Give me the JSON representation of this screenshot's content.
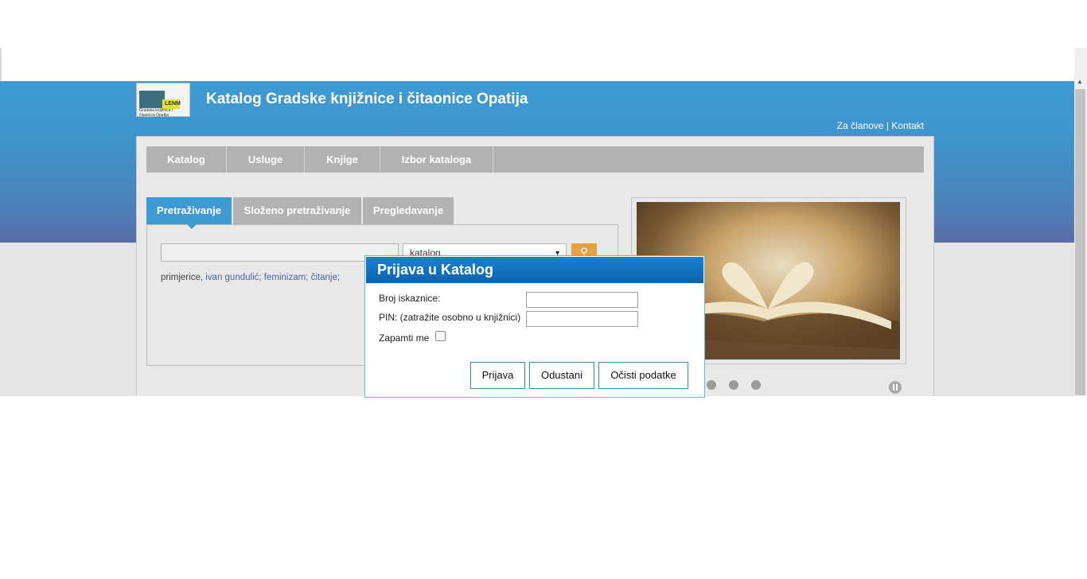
{
  "header": {
    "title": "Katalog Gradske knjižnice i čitaonice Opatija",
    "logo_text": "LENM",
    "logo_tagline": "Gradska knjižnica i čitaonica Opatija",
    "links": {
      "members": "Za članove",
      "separator": "|",
      "contact": "Kontakt"
    }
  },
  "menu": [
    "Katalog",
    "Usluge",
    "Knjige",
    "Izbor kataloga"
  ],
  "tabs": [
    "Pretraživanje",
    "Složeno pretraživanje",
    "Pregledavanje"
  ],
  "search": {
    "query": "",
    "select_value": "katalog",
    "tags_prefix": "primjerice,",
    "tags": [
      "ivan gundulić;",
      "feminizam;",
      "čitanje;"
    ]
  },
  "slider": {
    "dots": 3,
    "image_icon": "book-heart-photo"
  },
  "modal": {
    "title": "Prijava u Katalog",
    "card_label": "Broj iskaznice:",
    "pin_label": "PIN: (zatražite osobno u knjižnici)",
    "remember_label": "Zapamti me",
    "remember_checked": false,
    "login_button": "Prijava",
    "cancel_button": "Odustani",
    "clear_button": "Očisti podatke"
  },
  "colors": {
    "header_blue": "#3f9bd3",
    "tab_active": "#3f99d2",
    "search_button": "#e9a043",
    "modal_title": "#0a64ad"
  }
}
